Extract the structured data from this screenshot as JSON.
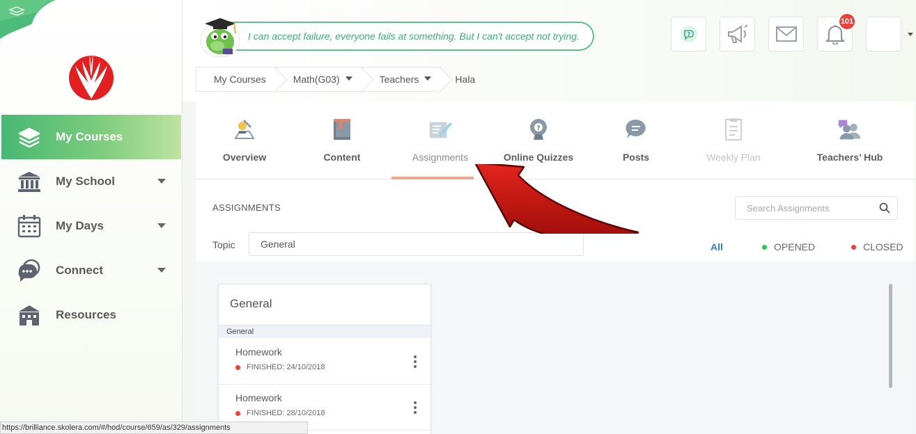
{
  "sidebar": {
    "items": [
      {
        "label": "My Courses",
        "icon": "layers-icon"
      },
      {
        "label": "My School",
        "icon": "school-building-icon"
      },
      {
        "label": "My Days",
        "icon": "calendar-icon"
      },
      {
        "label": "Connect",
        "icon": "chat-bubbles-icon"
      },
      {
        "label": "Resources",
        "icon": "library-icon"
      }
    ],
    "active_color": "#47b873"
  },
  "header": {
    "quote": "I can accept failure, everyone fails at something. But I can't accept not trying.",
    "notification_count": "101",
    "icons": [
      "help-chat-icon",
      "megaphone-icon",
      "mail-icon",
      "bell-icon",
      "user-avatar"
    ]
  },
  "breadcrumb": {
    "items": [
      "My Courses",
      "Math(G03)",
      "Teachers"
    ],
    "current": "Hala"
  },
  "tabs": [
    {
      "label": "Overview",
      "icon": "overview-icon"
    },
    {
      "label": "Content",
      "icon": "book-icon"
    },
    {
      "label": "Assignments",
      "icon": "assignment-icon",
      "active": true
    },
    {
      "label": "Online Quizzes",
      "icon": "quiz-icon"
    },
    {
      "label": "Posts",
      "icon": "posts-icon"
    },
    {
      "label": "Weekly Plan",
      "icon": "weekly-plan-icon",
      "disabled": true
    },
    {
      "label": "Teachers’ Hub",
      "icon": "teachers-hub-icon"
    }
  ],
  "assignments": {
    "section_title": "ASSIGNMENTS",
    "search_placeholder": "Search Assignments",
    "topic_label": "Topic",
    "topic_value": "General",
    "filters": {
      "all": "All",
      "opened": "OPENED",
      "closed": "CLOSED"
    },
    "filter_colors": {
      "all": "#2f7fd1",
      "opened": "#2fbf5f",
      "closed": "#e8423b"
    },
    "group": {
      "title": "General",
      "band": "General",
      "items": [
        {
          "name": "Homework",
          "status": "FINISHED: 24/10/2018"
        },
        {
          "name": "Homework",
          "status": "FINISHED: 28/10/2018"
        }
      ]
    }
  },
  "statusbar": {
    "url": "https://brilliance.skolera.com/#/hod/course/659/as/329/assignments"
  }
}
